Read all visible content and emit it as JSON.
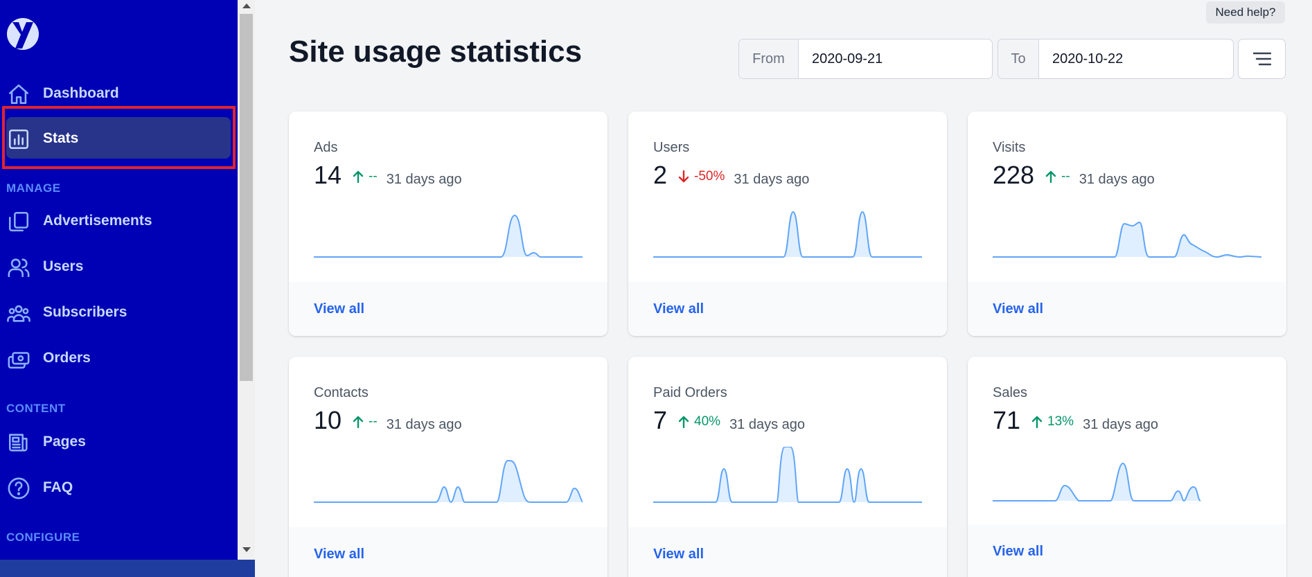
{
  "sidebar": {
    "logo_icon": "y-logo-icon",
    "items": [
      {
        "label": "Dashboard",
        "icon": "home-icon"
      },
      {
        "label": "Stats",
        "icon": "chart-bar-icon"
      },
      {
        "label": "Advertisements",
        "icon": "duplicate-icon"
      },
      {
        "label": "Users",
        "icon": "users-icon"
      },
      {
        "label": "Subscribers",
        "icon": "user-group-icon"
      },
      {
        "label": "Orders",
        "icon": "cash-icon"
      },
      {
        "label": "Pages",
        "icon": "newspaper-icon"
      },
      {
        "label": "FAQ",
        "icon": "question-circle-icon"
      }
    ],
    "sections": [
      "MANAGE",
      "CONTENT",
      "CONFIGURE"
    ],
    "active": "Stats"
  },
  "header": {
    "title": "Site usage statistics",
    "help_label": "Need help?",
    "from_label": "From",
    "from_value": "2020-09-21",
    "to_label": "To",
    "to_value": "2020-10-22",
    "filter_icon": "filter-lines-icon"
  },
  "cards": [
    {
      "title": "Ads",
      "value": "14",
      "direction": "up",
      "change": "--",
      "ago": "31 days ago",
      "link": "View all"
    },
    {
      "title": "Users",
      "value": "2",
      "direction": "down",
      "change": "-50%",
      "ago": "31 days ago",
      "link": "View all"
    },
    {
      "title": "Visits",
      "value": "228",
      "direction": "up",
      "change": "--",
      "ago": "31 days ago",
      "link": "View all"
    },
    {
      "title": "Contacts",
      "value": "10",
      "direction": "up",
      "change": "--",
      "ago": "31 days ago",
      "link": "View all"
    },
    {
      "title": "Paid Orders",
      "value": "7",
      "direction": "up",
      "change": "40%",
      "ago": "31 days ago",
      "link": "View all"
    },
    {
      "title": "Sales",
      "value": "71",
      "direction": "up",
      "change": "13%",
      "ago": "31 days ago",
      "link": "View all"
    }
  ],
  "colors": {
    "sidebar_bg": "#0000b4",
    "accent": "#2563eb",
    "up": "#059669",
    "down": "#dc2626",
    "sparkline": "#60a5fa"
  }
}
